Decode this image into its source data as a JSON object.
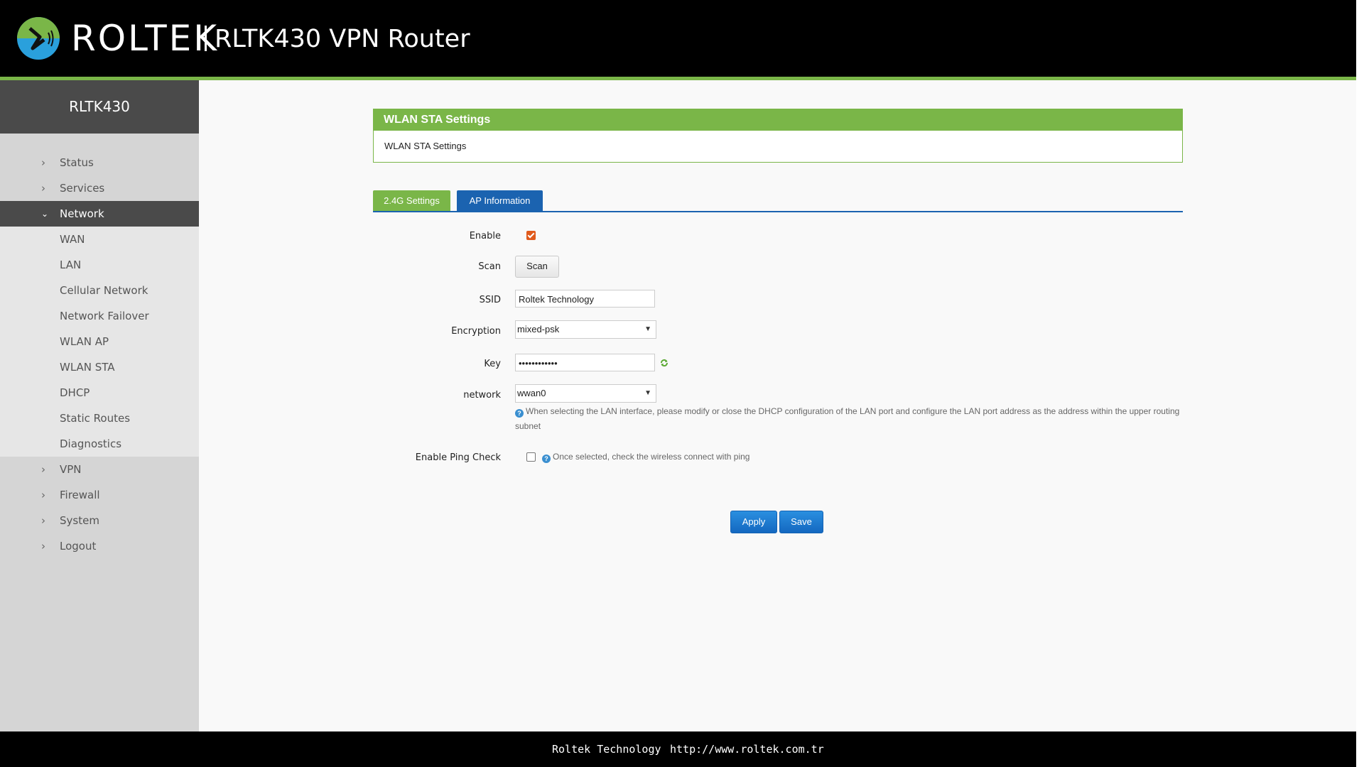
{
  "header": {
    "brand": "ROLTEK",
    "product": "RLTK430 VPN Router"
  },
  "sidebar": {
    "title": "RLTK430",
    "items": [
      {
        "label": "Status",
        "icon": "chevron-right-icon"
      },
      {
        "label": "Services",
        "icon": "chevron-right-icon"
      },
      {
        "label": "Network",
        "icon": "chevron-down-icon",
        "active": true
      },
      {
        "label": "VPN",
        "icon": "chevron-right-icon"
      },
      {
        "label": "Firewall",
        "icon": "chevron-right-icon"
      },
      {
        "label": "System",
        "icon": "chevron-right-icon"
      },
      {
        "label": "Logout",
        "icon": "chevron-right-icon"
      }
    ],
    "network_sub": [
      "WAN",
      "LAN",
      "Cellular Network",
      "Network Failover",
      "WLAN AP",
      "WLAN STA",
      "DHCP",
      "Static Routes",
      "Diagnostics"
    ]
  },
  "panel": {
    "title": "WLAN STA Settings",
    "description": "WLAN STA Settings"
  },
  "tabs": {
    "settings": "2.4G Settings",
    "ap_info": "AP Information"
  },
  "form": {
    "enable_label": "Enable",
    "enable_checked": true,
    "scan_label": "Scan",
    "scan_button": "Scan",
    "ssid_label": "SSID",
    "ssid_value": "Roltek Technology",
    "encryption_label": "Encryption",
    "encryption_value": "mixed-psk",
    "key_label": "Key",
    "key_value": "••••••••••••",
    "network_label": "network",
    "network_value": "wwan0",
    "network_help": "When selecting the LAN interface, please modify or close the DHCP configuration of the LAN port and configure the LAN port address as the address within the upper routing subnet",
    "ping_label": "Enable Ping Check",
    "ping_checked": false,
    "ping_help": "Once selected, check the wireless connect with ping"
  },
  "actions": {
    "apply": "Apply",
    "save": "Save"
  },
  "footer": {
    "company": "Roltek Technology",
    "url": "http://www.roltek.com.tr"
  },
  "colors": {
    "accent_green": "#7ab648",
    "accent_blue": "#1b63b0",
    "checkbox_orange": "#e05a1c"
  }
}
